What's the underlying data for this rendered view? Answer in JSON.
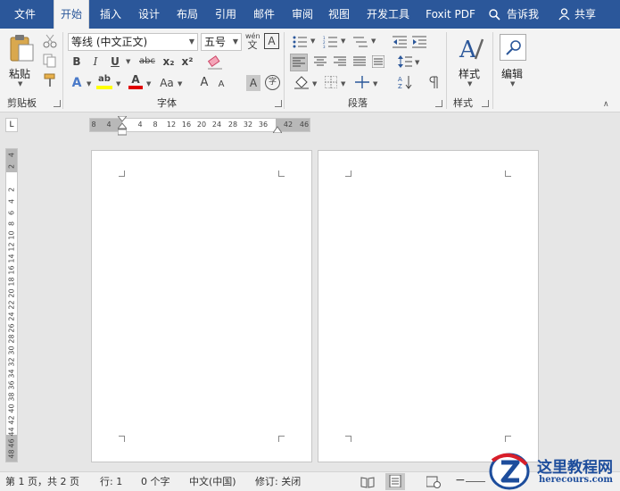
{
  "menu": {
    "tabs": [
      "文件",
      "开始",
      "插入",
      "设计",
      "布局",
      "引用",
      "邮件",
      "审阅",
      "视图",
      "开发工具",
      "Foxit PDF"
    ],
    "active_tab": "开始",
    "search_label": "告诉我",
    "share_label": "共享"
  },
  "ribbon": {
    "clipboard": {
      "paste_label": "粘贴",
      "group_label": "剪贴板"
    },
    "font": {
      "font_name": "等线 (中文正文)",
      "font_size": "五号",
      "group_label": "字体",
      "bold": "B",
      "italic": "I",
      "underline": "U",
      "strike": "abc",
      "subscript": "x₂",
      "superscript": "x²",
      "change_case": "Aa",
      "font_color_letter": "A",
      "highlight_letter": "ab",
      "grow": "A",
      "shrink": "A",
      "phonetic": "wén",
      "border_char": "A",
      "shade_char": "A",
      "enclose": "字"
    },
    "paragraph": {
      "group_label": "段落"
    },
    "styles": {
      "styles_label": "样式",
      "group_label": "样式"
    },
    "editing": {
      "edit_label": "编辑"
    },
    "colors": {
      "highlight": "#ffff00",
      "font_color": "#e00000",
      "accent": "#2b579a"
    }
  },
  "ruler": {
    "corner_icon": "L",
    "h_numbers": [
      "8",
      "4",
      "",
      "4",
      "8",
      "12",
      "16",
      "20",
      "24",
      "28",
      "32",
      "36",
      "",
      "42",
      "46"
    ],
    "v_numbers": [
      "4",
      "2",
      "",
      "2",
      "4",
      "6",
      "8",
      "10",
      "12",
      "14",
      "16",
      "18",
      "20",
      "22",
      "24",
      "26",
      "28",
      "30",
      "32",
      "34",
      "36",
      "38",
      "40",
      "42",
      "44",
      "46",
      "48"
    ]
  },
  "status": {
    "page": "第 1 页，共 2 页",
    "line": "行: 1",
    "words": "0 个字",
    "language": "中文(中国)",
    "track": "修订: 关闭"
  },
  "watermark": {
    "text": "这里教程网",
    "url_text": "herecours.com"
  }
}
